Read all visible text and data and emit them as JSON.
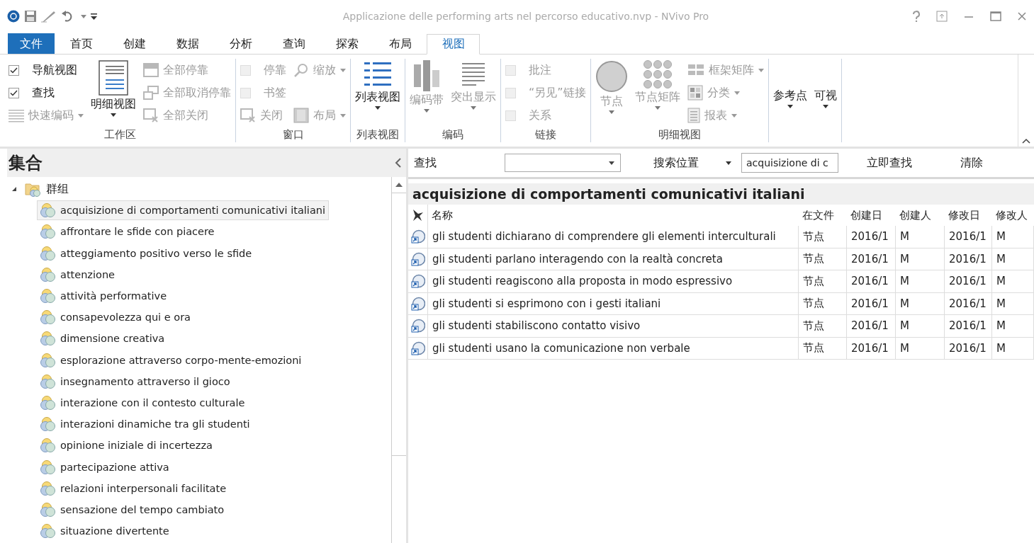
{
  "window": {
    "title": "Applicazione delle performing arts nel percorso educativo.nvp - NVivo Pro"
  },
  "tabs": [
    {
      "label": "文件",
      "kind": "file",
      "selected": false
    },
    {
      "label": "首页",
      "kind": "tab",
      "selected": false
    },
    {
      "label": "创建",
      "kind": "tab",
      "selected": false
    },
    {
      "label": "数据",
      "kind": "tab",
      "selected": false
    },
    {
      "label": "分析",
      "kind": "tab",
      "selected": false
    },
    {
      "label": "查询",
      "kind": "tab",
      "selected": false
    },
    {
      "label": "探索",
      "kind": "tab",
      "selected": false
    },
    {
      "label": "布局",
      "kind": "tab",
      "selected": false
    },
    {
      "label": "视图",
      "kind": "tab",
      "selected": true
    }
  ],
  "ribbon": {
    "groups": [
      {
        "label": "工作区",
        "columns": [
          [
            {
              "kind": "checkbox",
              "label": "导航视图",
              "checked": true,
              "disabled": false
            },
            {
              "kind": "checkbox",
              "label": "查找",
              "checked": true,
              "disabled": false
            },
            {
              "kind": "small",
              "label": "快速编码",
              "disabled": true,
              "dropdown": true
            }
          ],
          [
            {
              "kind": "large",
              "label": "明细视图",
              "disabled": false,
              "dropdown": true
            }
          ],
          [
            {
              "kind": "small",
              "label": "全部停靠",
              "disabled": true,
              "dropdown": false
            },
            {
              "kind": "small",
              "label": "全部取消停靠",
              "disabled": true,
              "dropdown": false
            },
            {
              "kind": "small",
              "label": "全部关闭",
              "disabled": true,
              "dropdown": false
            }
          ]
        ]
      },
      {
        "label": "窗口",
        "columns": [
          [
            {
              "kind": "checkbox",
              "label": "停靠",
              "checked": false,
              "disabled": true
            },
            {
              "kind": "checkbox",
              "label": "书签",
              "checked": false,
              "disabled": true
            },
            {
              "kind": "small",
              "label": "关闭",
              "disabled": true,
              "dropdown": false
            }
          ],
          [
            {
              "kind": "small",
              "label": "缩放",
              "disabled": true,
              "dropdown": true
            },
            {
              "kind": "small",
              "label": "布局",
              "disabled": true,
              "dropdown": true
            }
          ]
        ]
      },
      {
        "label": "列表视图",
        "columns": [
          [
            {
              "kind": "large",
              "label": "列表视图",
              "disabled": false,
              "dropdown": true
            }
          ]
        ]
      },
      {
        "label": "编码",
        "columns": [
          [
            {
              "kind": "large",
              "label": "编码带",
              "disabled": true,
              "dropdown": true
            }
          ],
          [
            {
              "kind": "large",
              "label": "突出显示",
              "disabled": true,
              "dropdown": true
            }
          ]
        ]
      },
      {
        "label": "链接",
        "columns": [
          [
            {
              "kind": "checkbox",
              "label": "批注",
              "checked": false,
              "disabled": true
            },
            {
              "kind": "checkbox",
              "label": "“另见”链接",
              "checked": false,
              "disabled": true
            },
            {
              "kind": "checkbox",
              "label": "关系",
              "checked": false,
              "disabled": true
            }
          ]
        ]
      },
      {
        "label": "明细视图",
        "columns": [
          [
            {
              "kind": "large",
              "label": "节点",
              "disabled": true,
              "dropdown": true
            }
          ],
          [
            {
              "kind": "large",
              "label": "节点矩阵",
              "disabled": true,
              "dropdown": true
            }
          ],
          [
            {
              "kind": "small",
              "label": "框架矩阵",
              "disabled": true,
              "dropdown": true
            },
            {
              "kind": "small",
              "label": "分类",
              "disabled": true,
              "dropdown": true
            },
            {
              "kind": "small",
              "label": "报表",
              "disabled": true,
              "dropdown": true
            }
          ]
        ]
      },
      {
        "columns": [
          [
            {
              "kind": "large",
              "label": "参考点",
              "disabled": false,
              "dropdown": true
            }
          ],
          [
            {
              "kind": "large",
              "label": "可视",
              "disabled": false,
              "dropdown": true
            }
          ]
        ]
      }
    ]
  },
  "navigation": {
    "title": "集合",
    "tree": [
      {
        "label": "群组",
        "expanded": true,
        "selected": false,
        "children": [
          {
            "label": "acquisizione di comportamenti comunicativi italiani",
            "selected": true
          },
          {
            "label": "affrontare le sfide con piacere",
            "selected": false
          },
          {
            "label": "atteggiamento positivo verso le sfide",
            "selected": false
          },
          {
            "label": "attenzione",
            "selected": false
          },
          {
            "label": "attività performative",
            "selected": false
          },
          {
            "label": "consapevolezza qui e ora",
            "selected": false
          },
          {
            "label": "dimensione creativa",
            "selected": false
          },
          {
            "label": "esplorazione attraverso corpo-mente-emozioni",
            "selected": false
          },
          {
            "label": "insegnamento attraverso il gioco",
            "selected": false
          },
          {
            "label": "interazione con il contesto culturale",
            "selected": false
          },
          {
            "label": "interazioni dinamiche tra gli studenti",
            "selected": false
          },
          {
            "label": "opinione iniziale di incertezza",
            "selected": false
          },
          {
            "label": "partecipazione attiva",
            "selected": false
          },
          {
            "label": "relazioni interpersonali facilitate",
            "selected": false
          },
          {
            "label": "sensazione del tempo cambiato",
            "selected": false
          },
          {
            "label": "situazione divertente",
            "selected": false
          }
        ]
      }
    ]
  },
  "find_bar": {
    "label": "查找",
    "search_in": "搜索位置",
    "query": "acquisizione di c",
    "find_now": "立即查找",
    "clear": "清除"
  },
  "detail": {
    "title": "acquisizione di comportamenti comunicativi italiani",
    "columns": [
      "名称",
      "在文件",
      "创建日",
      "创建人",
      "修改日",
      "修改人"
    ],
    "rows": [
      [
        "gli studenti dichiarano di comprendere gli elementi interculturali",
        "节点",
        "2016/1",
        "M",
        "2016/1",
        "M"
      ],
      [
        "gli studenti parlano interagendo con la realtà concreta",
        "节点",
        "2016/1",
        "M",
        "2016/1",
        "M"
      ],
      [
        "gli studenti reagiscono alla proposta in modo espressivo",
        "节点",
        "2016/1",
        "M",
        "2016/1",
        "M"
      ],
      [
        "gli studenti si esprimono con i gesti italiani",
        "节点",
        "2016/1",
        "M",
        "2016/1",
        "M"
      ],
      [
        "gli studenti stabiliscono contatto visivo",
        "节点",
        "2016/1",
        "M",
        "2016/1",
        "M"
      ],
      [
        "gli studenti usano la comunicazione non verbale",
        "节点",
        "2016/1",
        "M",
        "2016/1",
        "M"
      ]
    ]
  }
}
